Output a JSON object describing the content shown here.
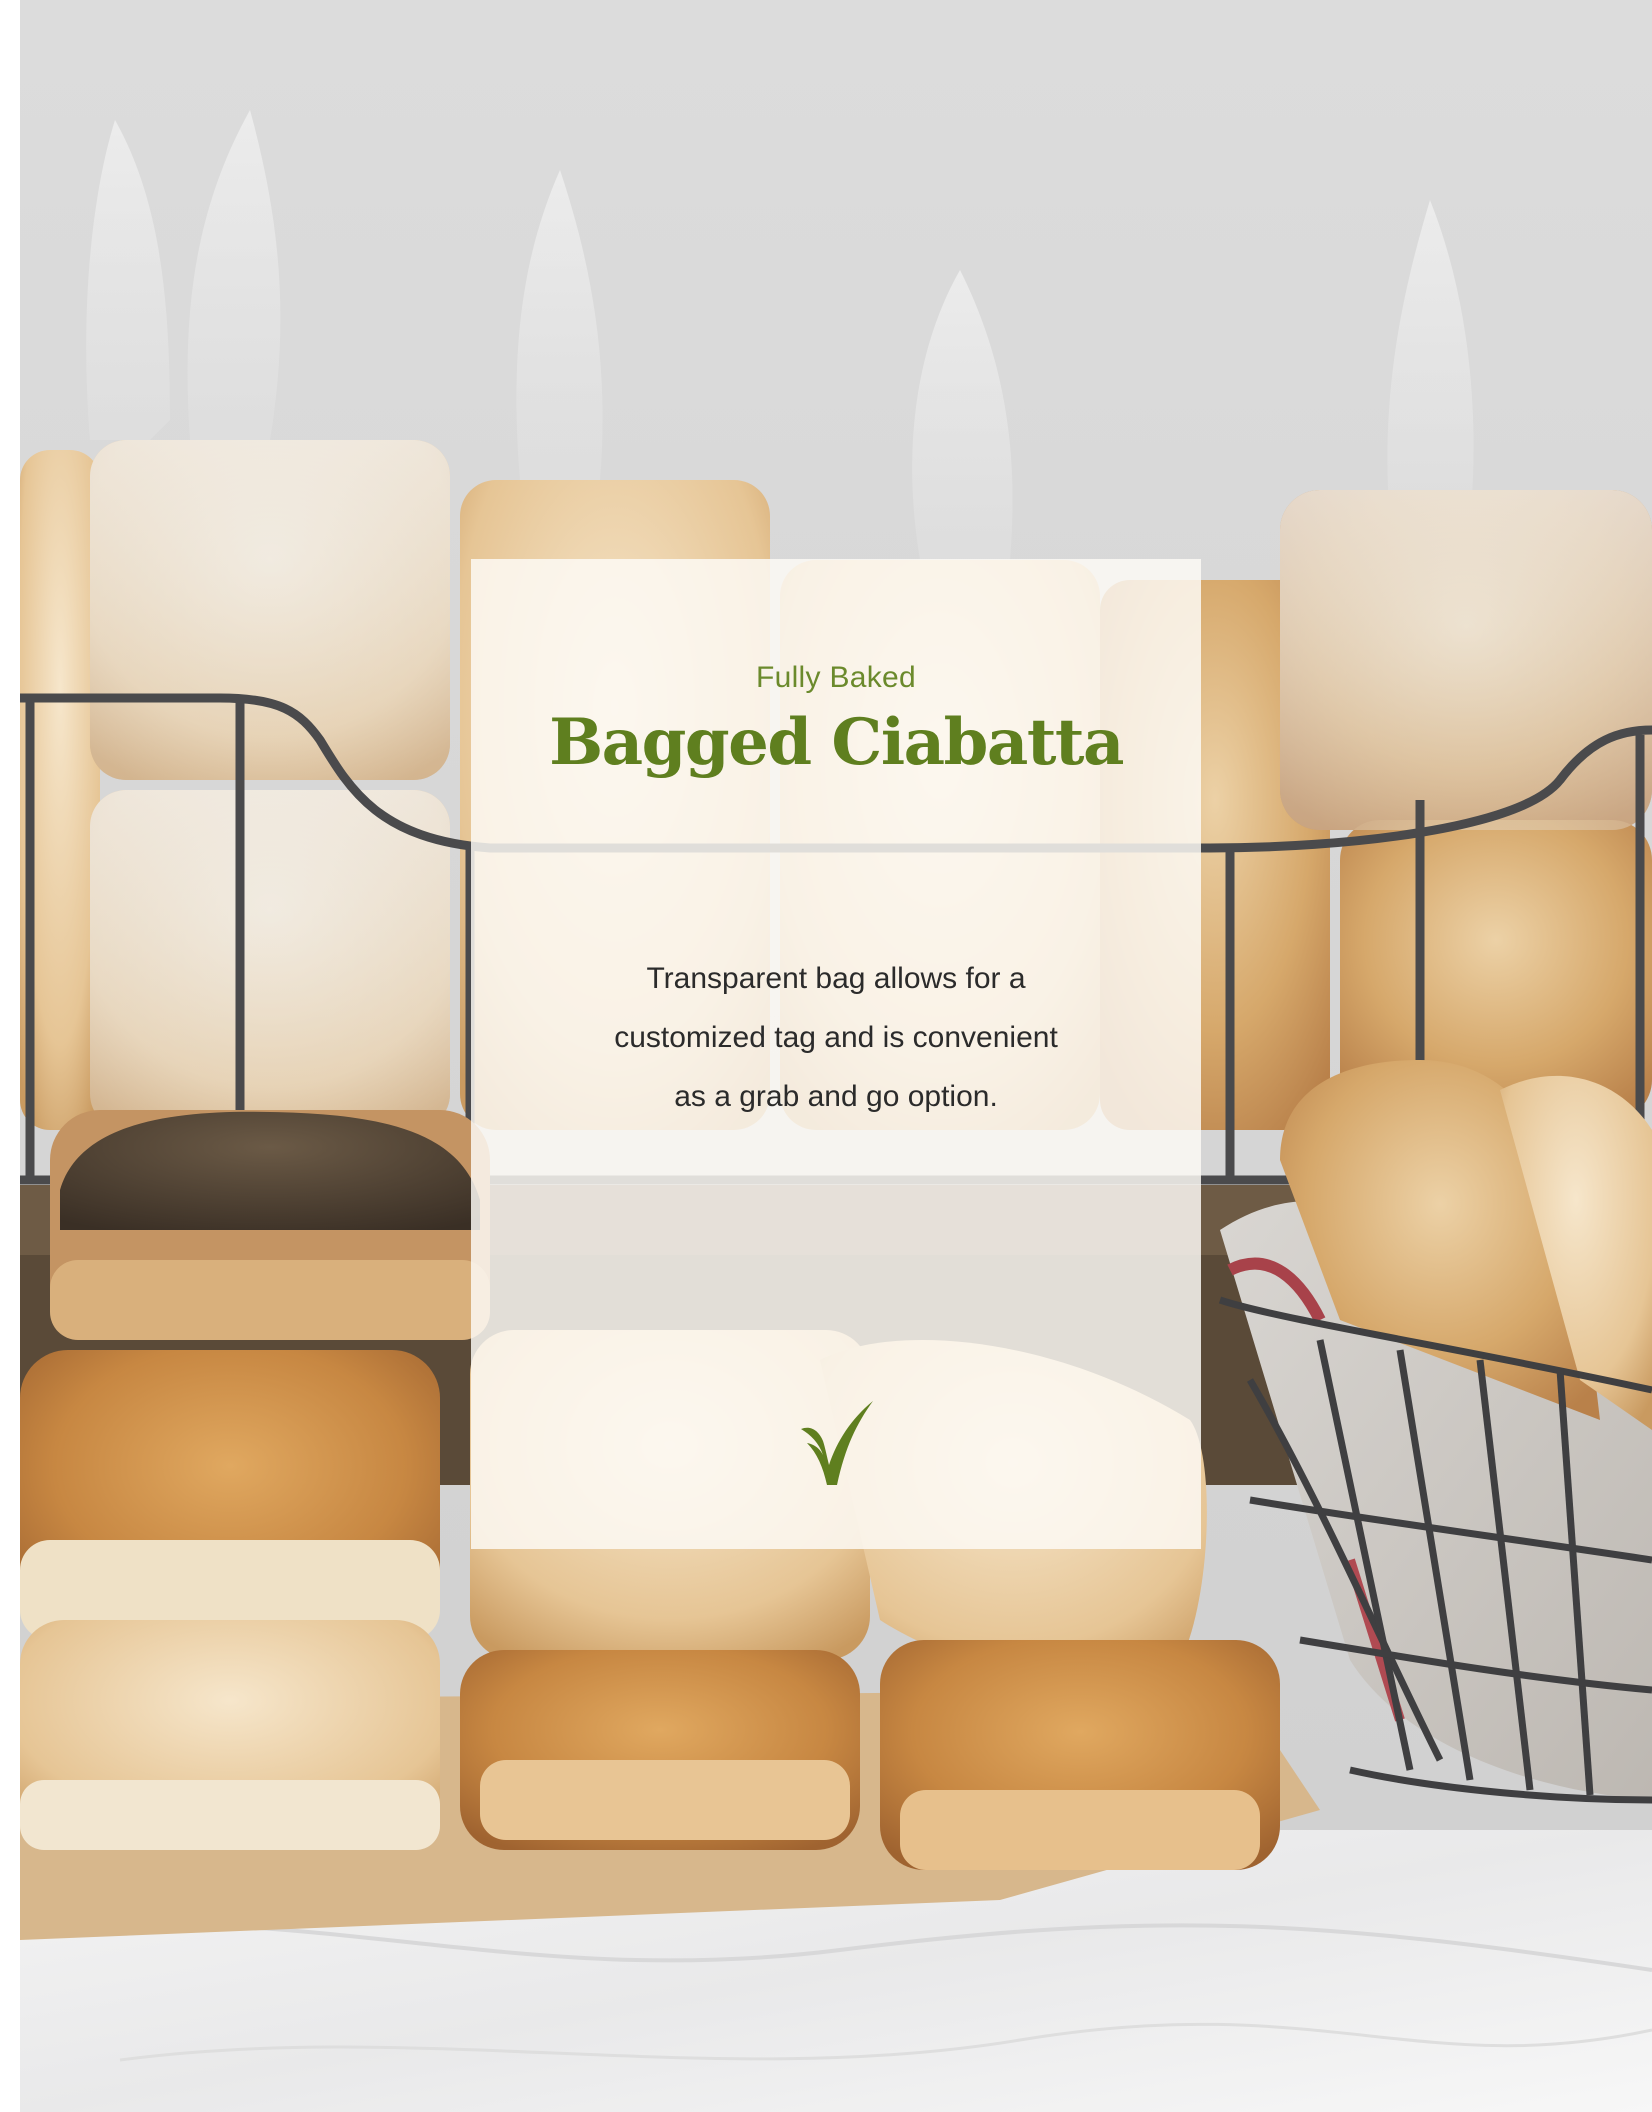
{
  "card": {
    "eyebrow": "Fully Baked",
    "title": "Bagged Ciabatta",
    "description_lines": [
      "Transparent bag allows for a",
      "customized tag and is convenient",
      "as a grab and go option."
    ]
  },
  "logo": {
    "icon": "leaf-checkmark-icon",
    "color": "#5f7f1f"
  },
  "colors": {
    "eyebrow": "#6b8a2c",
    "title": "#5f7f1f",
    "body": "#2b2b2b"
  }
}
